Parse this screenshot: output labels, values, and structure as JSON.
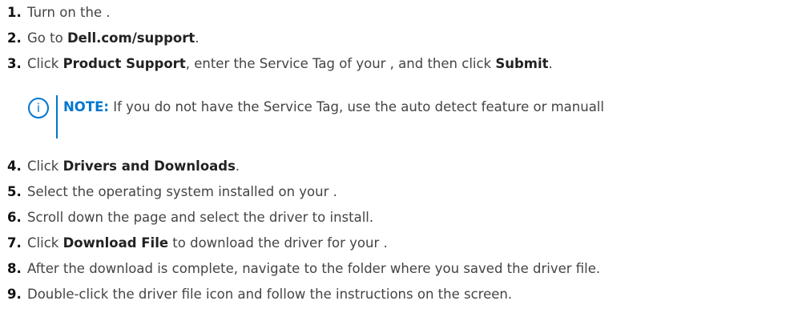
{
  "steps": [
    {
      "num": "1.",
      "parts": [
        {
          "t": "Turn on the .",
          "b": false
        }
      ]
    },
    {
      "num": "2.",
      "parts": [
        {
          "t": "Go to ",
          "b": false
        },
        {
          "t": "Dell.com/support",
          "b": true
        },
        {
          "t": ".",
          "b": false
        }
      ]
    },
    {
      "num": "3.",
      "parts": [
        {
          "t": "Click ",
          "b": false
        },
        {
          "t": "Product Support",
          "b": true
        },
        {
          "t": ", enter the Service Tag of your , and then click ",
          "b": false
        },
        {
          "t": "Submit",
          "b": true
        },
        {
          "t": ".",
          "b": false
        }
      ]
    },
    {
      "num": "4.",
      "parts": [
        {
          "t": "Click ",
          "b": false
        },
        {
          "t": "Drivers and Downloads",
          "b": true
        },
        {
          "t": ".",
          "b": false
        }
      ]
    },
    {
      "num": "5.",
      "parts": [
        {
          "t": "Select the operating system installed on your .",
          "b": false
        }
      ]
    },
    {
      "num": "6.",
      "parts": [
        {
          "t": "Scroll down the page and select the driver to install.",
          "b": false
        }
      ]
    },
    {
      "num": "7.",
      "parts": [
        {
          "t": "Click ",
          "b": false
        },
        {
          "t": "Download File",
          "b": true
        },
        {
          "t": " to download the driver for your .",
          "b": false
        }
      ]
    },
    {
      "num": "8.",
      "parts": [
        {
          "t": "After the download is complete, navigate to the folder where you saved the driver file.",
          "b": false
        }
      ]
    },
    {
      "num": "9.",
      "parts": [
        {
          "t": "Double-click the driver file icon and follow the instructions on the screen.",
          "b": false
        }
      ]
    }
  ],
  "note": {
    "label": "NOTE:",
    "text": " If you do not have the Service Tag, use the auto detect feature or manuall",
    "icon": "info-icon",
    "icon_glyph": "i",
    "accent_color": "#0076CE"
  }
}
